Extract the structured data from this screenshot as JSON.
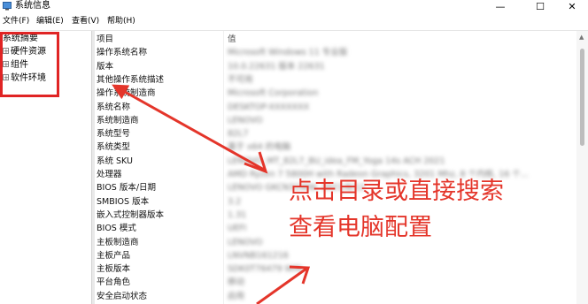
{
  "window": {
    "title": "系统信息",
    "minimize_glyph": "—",
    "maximize_glyph": "☐",
    "close_glyph": "✕"
  },
  "menu": {
    "items": [
      "文件(F)",
      "编辑(E)",
      "查看(V)",
      "帮助(H)"
    ]
  },
  "tree": {
    "root": "系统摘要",
    "children": [
      {
        "label": "硬件资源",
        "expander": "+"
      },
      {
        "label": "组件",
        "expander": "+"
      },
      {
        "label": "软件环境",
        "expander": "+"
      }
    ]
  },
  "grid": {
    "header": {
      "key": "项目",
      "value": "值"
    },
    "rows": [
      {
        "key": "操作系统名称",
        "value": "Microsoft Windows 11 专业版"
      },
      {
        "key": "版本",
        "value": "10.0.22631 版本 22631"
      },
      {
        "key": "其他操作系统描述",
        "value": "不可用"
      },
      {
        "key": "操作系统制造商",
        "value": "Microsoft Corporation"
      },
      {
        "key": "系统名称",
        "value": "DESKTOP-XXXXXXX"
      },
      {
        "key": "系统制造商",
        "value": "LENOVO"
      },
      {
        "key": "系统型号",
        "value": "82L7"
      },
      {
        "key": "系统类型",
        "value": "基于 x64 的电脑"
      },
      {
        "key": "系统 SKU",
        "value": "LENOVO_MT_82L7_BU_idea_FM_Yoga 14s ACH 2021"
      },
      {
        "key": "处理器",
        "value": "AMD Ryzen 7 5800H with Radeon Graphics, 3201 Mhz, 8 个内核, 16 个..."
      },
      {
        "key": "BIOS 版本/日期",
        "value": "LENOVO GKCN31WW, 2021/8/12"
      },
      {
        "key": "SMBIOS 版本",
        "value": "3.2"
      },
      {
        "key": "嵌入式控制器版本",
        "value": "1.31"
      },
      {
        "key": "BIOS 模式",
        "value": "UEFI"
      },
      {
        "key": "主板制造商",
        "value": "LENOVO"
      },
      {
        "key": "主板产品",
        "value": "LNVNB161216"
      },
      {
        "key": "主板版本",
        "value": "SDK0T76479 WIN"
      },
      {
        "key": "平台角色",
        "value": "移动"
      },
      {
        "key": "安全启动状态",
        "value": "启用"
      }
    ]
  },
  "annotation": {
    "line1": "点击目录或直接搜索",
    "line2": "查看电脑配置"
  },
  "colors": {
    "annotation_red": "#e4352a",
    "box_red": "#e02424"
  }
}
